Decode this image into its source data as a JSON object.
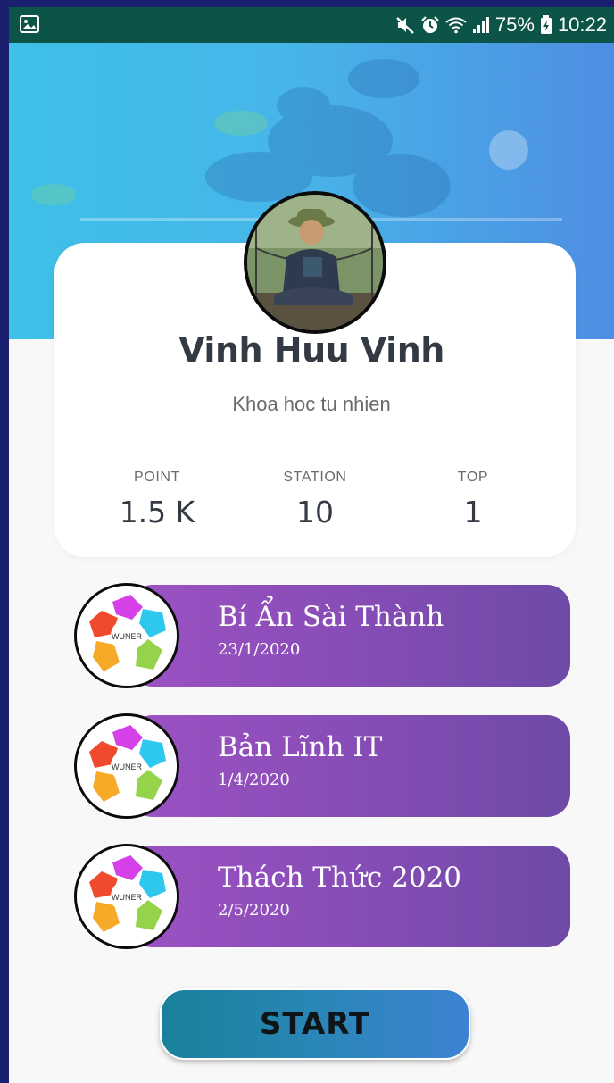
{
  "status_bar": {
    "battery": "75%",
    "time": "10:22",
    "icons": [
      "gallery-icon",
      "mute-icon",
      "alarm-icon",
      "wifi-icon",
      "signal-icon",
      "battery-icon"
    ]
  },
  "profile": {
    "name": "Vinh Huu Vinh",
    "subtitle": "Khoa hoc tu nhien"
  },
  "stats": [
    {
      "label": "POINT",
      "value": "1.5 K"
    },
    {
      "label": "STATION",
      "value": "10"
    },
    {
      "label": "TOP",
      "value": "1"
    }
  ],
  "events": [
    {
      "title": "Bí Ẩn Sài Thành",
      "date": "23/1/2020",
      "logo_text": "WUNER"
    },
    {
      "title": "Bản Lĩnh IT",
      "date": "1/4/2020",
      "logo_text": "WUNER"
    },
    {
      "title": "Thách Thức 2020",
      "date": "2/5/2020",
      "logo_text": "WUNER"
    }
  ],
  "start_button": {
    "label": "START"
  },
  "colors": {
    "status_bar": "#0c5448",
    "banner_start": "#3ec0e8",
    "banner_end": "#4f8ee3",
    "event_pill_start": "#9b52c2",
    "event_pill_end": "#6e4aa6",
    "start_button_start": "#18819a",
    "start_button_end": "#3d83d2"
  }
}
